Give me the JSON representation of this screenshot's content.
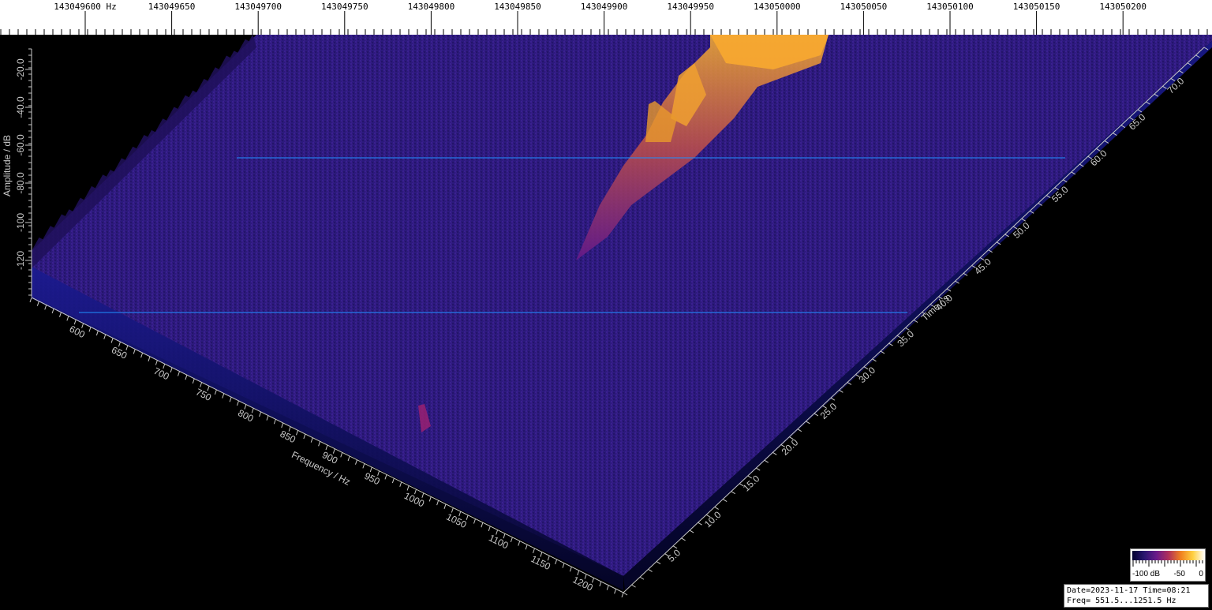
{
  "window": {
    "view_type": "3D spectrum waterfall"
  },
  "top_scale": {
    "unit": "Hz",
    "labels": [
      "143049600",
      "143049650",
      "143049700",
      "143049750",
      "143049800",
      "143049850",
      "143049900",
      "143049950",
      "143050000",
      "143050050",
      "143050100",
      "143050150",
      "143050200"
    ]
  },
  "amplitude_axis": {
    "label": "Amplitude / dB",
    "ticks": [
      "-20.0",
      "-40.0",
      "-60.0",
      "-80.0",
      "-100",
      "-120"
    ]
  },
  "frequency_axis": {
    "label": "Frequency / Hz",
    "ticks": [
      "600",
      "650",
      "700",
      "750",
      "800",
      "850",
      "900",
      "950",
      "1000",
      "1050",
      "1100",
      "1150",
      "1200"
    ]
  },
  "time_axis": {
    "label": "Time / s",
    "ticks": [
      "5.0",
      "10.0",
      "15.0",
      "20.0",
      "25.0",
      "30.0",
      "35.0",
      "40.0",
      "45.0",
      "50.0",
      "55.0",
      "60.0",
      "65.0",
      "70.0"
    ]
  },
  "colorbar": {
    "labels": [
      "-100 dB",
      "-50",
      "0"
    ],
    "colors": [
      "#000030",
      "#2a1670",
      "#6a1a8a",
      "#b0305a",
      "#f08020",
      "#ffd040",
      "#ffffff"
    ]
  },
  "info": {
    "date_label": "Date=",
    "date": "2023-11-17",
    "time_label": "Time=",
    "time": "08:21",
    "freq_label": "Freq=",
    "freq_range": "551.5...1251.5 Hz"
  },
  "markers": {
    "color": "#1e90ff"
  },
  "spectrum": {
    "floor_color": "#2a1a7a",
    "signal_color": "#f0a020"
  }
}
